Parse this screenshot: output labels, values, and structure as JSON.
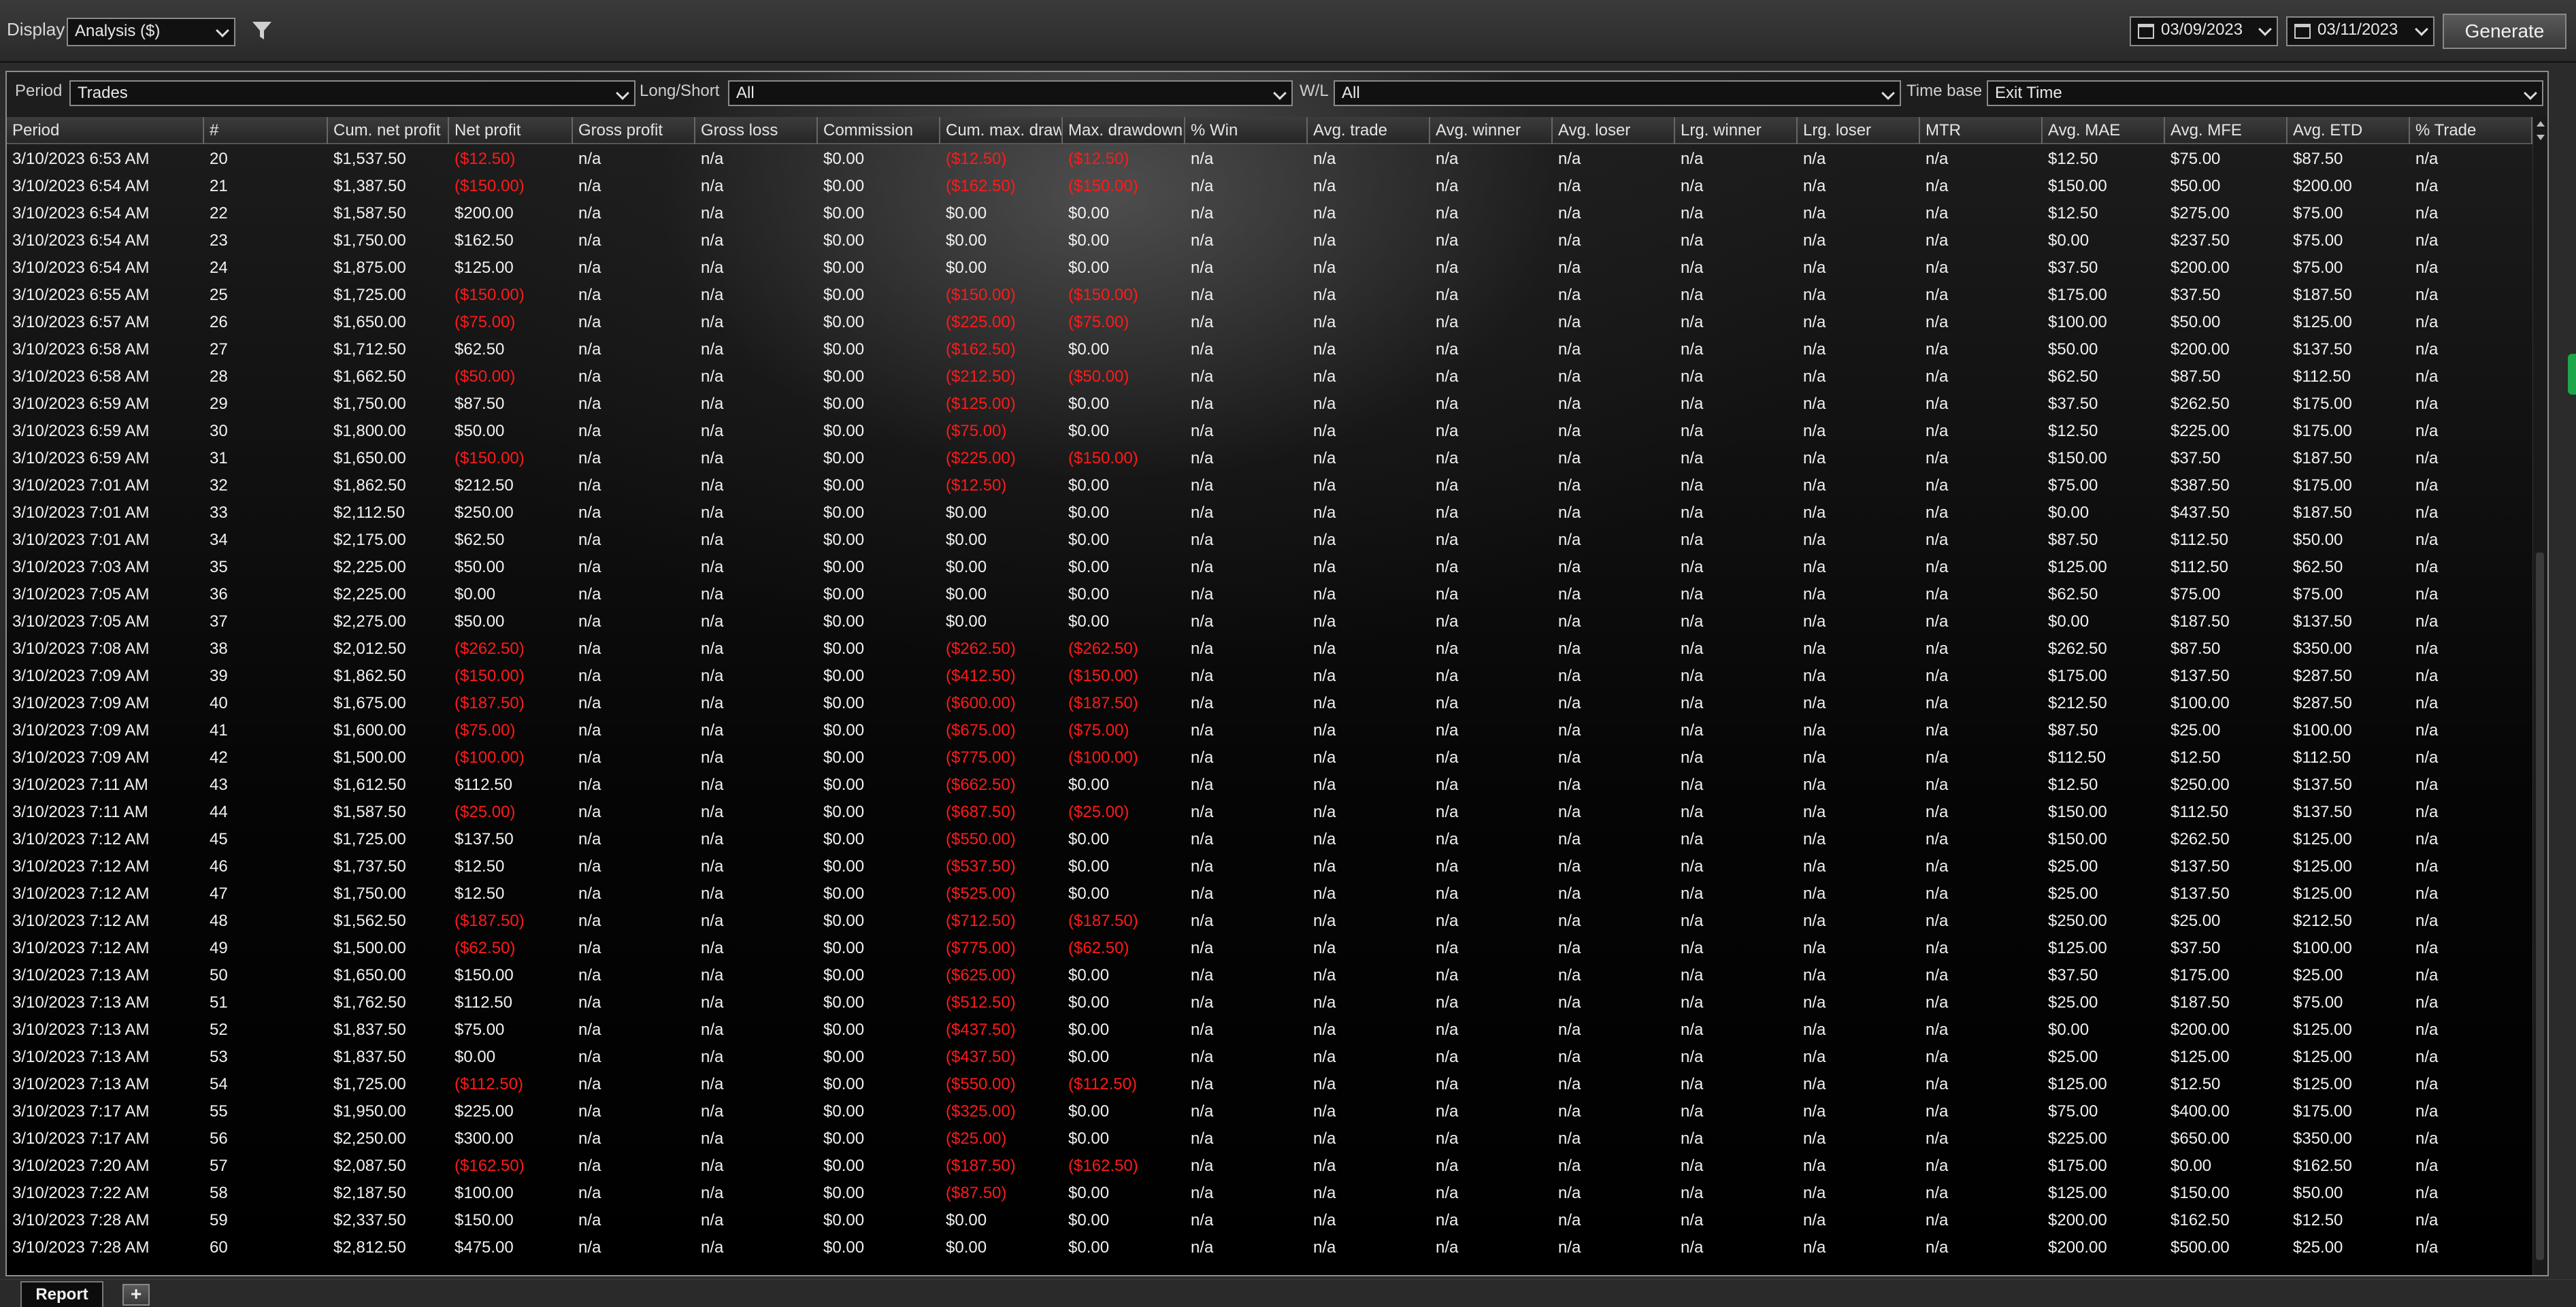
{
  "toolbar": {
    "display_label": "Display",
    "display_value": "Analysis ($)",
    "date_start": "03/09/2023",
    "date_end": "03/11/2023",
    "generate_label": "Generate"
  },
  "filters": {
    "period_label": "Period",
    "period_value": "Trades",
    "longshort_label": "Long/Short",
    "longshort_value": "All",
    "wl_label": "W/L",
    "wl_value": "All",
    "timebase_label": "Time base",
    "timebase_value": "Exit Time"
  },
  "columns": [
    "Period",
    "#",
    "Cum. net profit",
    "Net profit",
    "Gross profit",
    "Gross loss",
    "Commission",
    "Cum. max. drawdown",
    "Max. drawdown",
    "% Win",
    "Avg. trade",
    "Avg. winner",
    "Avg. loser",
    "Lrg. winner",
    "Lrg. loser",
    "MTR",
    "Avg. MAE",
    "Avg. MFE",
    "Avg. ETD",
    "% Trade"
  ],
  "rows": [
    [
      "3/10/2023 6:53 AM",
      "20",
      "$1,537.50",
      "($12.50)",
      "n/a",
      "n/a",
      "$0.00",
      "($12.50)",
      "($12.50)",
      "n/a",
      "n/a",
      "n/a",
      "n/a",
      "n/a",
      "n/a",
      "n/a",
      "$12.50",
      "$75.00",
      "$87.50",
      "n/a"
    ],
    [
      "3/10/2023 6:54 AM",
      "21",
      "$1,387.50",
      "($150.00)",
      "n/a",
      "n/a",
      "$0.00",
      "($162.50)",
      "($150.00)",
      "n/a",
      "n/a",
      "n/a",
      "n/a",
      "n/a",
      "n/a",
      "n/a",
      "$150.00",
      "$50.00",
      "$200.00",
      "n/a"
    ],
    [
      "3/10/2023 6:54 AM",
      "22",
      "$1,587.50",
      "$200.00",
      "n/a",
      "n/a",
      "$0.00",
      "$0.00",
      "$0.00",
      "n/a",
      "n/a",
      "n/a",
      "n/a",
      "n/a",
      "n/a",
      "n/a",
      "$12.50",
      "$275.00",
      "$75.00",
      "n/a"
    ],
    [
      "3/10/2023 6:54 AM",
      "23",
      "$1,750.00",
      "$162.50",
      "n/a",
      "n/a",
      "$0.00",
      "$0.00",
      "$0.00",
      "n/a",
      "n/a",
      "n/a",
      "n/a",
      "n/a",
      "n/a",
      "n/a",
      "$0.00",
      "$237.50",
      "$75.00",
      "n/a"
    ],
    [
      "3/10/2023 6:54 AM",
      "24",
      "$1,875.00",
      "$125.00",
      "n/a",
      "n/a",
      "$0.00",
      "$0.00",
      "$0.00",
      "n/a",
      "n/a",
      "n/a",
      "n/a",
      "n/a",
      "n/a",
      "n/a",
      "$37.50",
      "$200.00",
      "$75.00",
      "n/a"
    ],
    [
      "3/10/2023 6:55 AM",
      "25",
      "$1,725.00",
      "($150.00)",
      "n/a",
      "n/a",
      "$0.00",
      "($150.00)",
      "($150.00)",
      "n/a",
      "n/a",
      "n/a",
      "n/a",
      "n/a",
      "n/a",
      "n/a",
      "$175.00",
      "$37.50",
      "$187.50",
      "n/a"
    ],
    [
      "3/10/2023 6:57 AM",
      "26",
      "$1,650.00",
      "($75.00)",
      "n/a",
      "n/a",
      "$0.00",
      "($225.00)",
      "($75.00)",
      "n/a",
      "n/a",
      "n/a",
      "n/a",
      "n/a",
      "n/a",
      "n/a",
      "$100.00",
      "$50.00",
      "$125.00",
      "n/a"
    ],
    [
      "3/10/2023 6:58 AM",
      "27",
      "$1,712.50",
      "$62.50",
      "n/a",
      "n/a",
      "$0.00",
      "($162.50)",
      "$0.00",
      "n/a",
      "n/a",
      "n/a",
      "n/a",
      "n/a",
      "n/a",
      "n/a",
      "$50.00",
      "$200.00",
      "$137.50",
      "n/a"
    ],
    [
      "3/10/2023 6:58 AM",
      "28",
      "$1,662.50",
      "($50.00)",
      "n/a",
      "n/a",
      "$0.00",
      "($212.50)",
      "($50.00)",
      "n/a",
      "n/a",
      "n/a",
      "n/a",
      "n/a",
      "n/a",
      "n/a",
      "$62.50",
      "$87.50",
      "$112.50",
      "n/a"
    ],
    [
      "3/10/2023 6:59 AM",
      "29",
      "$1,750.00",
      "$87.50",
      "n/a",
      "n/a",
      "$0.00",
      "($125.00)",
      "$0.00",
      "n/a",
      "n/a",
      "n/a",
      "n/a",
      "n/a",
      "n/a",
      "n/a",
      "$37.50",
      "$262.50",
      "$175.00",
      "n/a"
    ],
    [
      "3/10/2023 6:59 AM",
      "30",
      "$1,800.00",
      "$50.00",
      "n/a",
      "n/a",
      "$0.00",
      "($75.00)",
      "$0.00",
      "n/a",
      "n/a",
      "n/a",
      "n/a",
      "n/a",
      "n/a",
      "n/a",
      "$12.50",
      "$225.00",
      "$175.00",
      "n/a"
    ],
    [
      "3/10/2023 6:59 AM",
      "31",
      "$1,650.00",
      "($150.00)",
      "n/a",
      "n/a",
      "$0.00",
      "($225.00)",
      "($150.00)",
      "n/a",
      "n/a",
      "n/a",
      "n/a",
      "n/a",
      "n/a",
      "n/a",
      "$150.00",
      "$37.50",
      "$187.50",
      "n/a"
    ],
    [
      "3/10/2023 7:01 AM",
      "32",
      "$1,862.50",
      "$212.50",
      "n/a",
      "n/a",
      "$0.00",
      "($12.50)",
      "$0.00",
      "n/a",
      "n/a",
      "n/a",
      "n/a",
      "n/a",
      "n/a",
      "n/a",
      "$75.00",
      "$387.50",
      "$175.00",
      "n/a"
    ],
    [
      "3/10/2023 7:01 AM",
      "33",
      "$2,112.50",
      "$250.00",
      "n/a",
      "n/a",
      "$0.00",
      "$0.00",
      "$0.00",
      "n/a",
      "n/a",
      "n/a",
      "n/a",
      "n/a",
      "n/a",
      "n/a",
      "$0.00",
      "$437.50",
      "$187.50",
      "n/a"
    ],
    [
      "3/10/2023 7:01 AM",
      "34",
      "$2,175.00",
      "$62.50",
      "n/a",
      "n/a",
      "$0.00",
      "$0.00",
      "$0.00",
      "n/a",
      "n/a",
      "n/a",
      "n/a",
      "n/a",
      "n/a",
      "n/a",
      "$87.50",
      "$112.50",
      "$50.00",
      "n/a"
    ],
    [
      "3/10/2023 7:03 AM",
      "35",
      "$2,225.00",
      "$50.00",
      "n/a",
      "n/a",
      "$0.00",
      "$0.00",
      "$0.00",
      "n/a",
      "n/a",
      "n/a",
      "n/a",
      "n/a",
      "n/a",
      "n/a",
      "$125.00",
      "$112.50",
      "$62.50",
      "n/a"
    ],
    [
      "3/10/2023 7:05 AM",
      "36",
      "$2,225.00",
      "$0.00",
      "n/a",
      "n/a",
      "$0.00",
      "$0.00",
      "$0.00",
      "n/a",
      "n/a",
      "n/a",
      "n/a",
      "n/a",
      "n/a",
      "n/a",
      "$62.50",
      "$75.00",
      "$75.00",
      "n/a"
    ],
    [
      "3/10/2023 7:05 AM",
      "37",
      "$2,275.00",
      "$50.00",
      "n/a",
      "n/a",
      "$0.00",
      "$0.00",
      "$0.00",
      "n/a",
      "n/a",
      "n/a",
      "n/a",
      "n/a",
      "n/a",
      "n/a",
      "$0.00",
      "$187.50",
      "$137.50",
      "n/a"
    ],
    [
      "3/10/2023 7:08 AM",
      "38",
      "$2,012.50",
      "($262.50)",
      "n/a",
      "n/a",
      "$0.00",
      "($262.50)",
      "($262.50)",
      "n/a",
      "n/a",
      "n/a",
      "n/a",
      "n/a",
      "n/a",
      "n/a",
      "$262.50",
      "$87.50",
      "$350.00",
      "n/a"
    ],
    [
      "3/10/2023 7:09 AM",
      "39",
      "$1,862.50",
      "($150.00)",
      "n/a",
      "n/a",
      "$0.00",
      "($412.50)",
      "($150.00)",
      "n/a",
      "n/a",
      "n/a",
      "n/a",
      "n/a",
      "n/a",
      "n/a",
      "$175.00",
      "$137.50",
      "$287.50",
      "n/a"
    ],
    [
      "3/10/2023 7:09 AM",
      "40",
      "$1,675.00",
      "($187.50)",
      "n/a",
      "n/a",
      "$0.00",
      "($600.00)",
      "($187.50)",
      "n/a",
      "n/a",
      "n/a",
      "n/a",
      "n/a",
      "n/a",
      "n/a",
      "$212.50",
      "$100.00",
      "$287.50",
      "n/a"
    ],
    [
      "3/10/2023 7:09 AM",
      "41",
      "$1,600.00",
      "($75.00)",
      "n/a",
      "n/a",
      "$0.00",
      "($675.00)",
      "($75.00)",
      "n/a",
      "n/a",
      "n/a",
      "n/a",
      "n/a",
      "n/a",
      "n/a",
      "$87.50",
      "$25.00",
      "$100.00",
      "n/a"
    ],
    [
      "3/10/2023 7:09 AM",
      "42",
      "$1,500.00",
      "($100.00)",
      "n/a",
      "n/a",
      "$0.00",
      "($775.00)",
      "($100.00)",
      "n/a",
      "n/a",
      "n/a",
      "n/a",
      "n/a",
      "n/a",
      "n/a",
      "$112.50",
      "$12.50",
      "$112.50",
      "n/a"
    ],
    [
      "3/10/2023 7:11 AM",
      "43",
      "$1,612.50",
      "$112.50",
      "n/a",
      "n/a",
      "$0.00",
      "($662.50)",
      "$0.00",
      "n/a",
      "n/a",
      "n/a",
      "n/a",
      "n/a",
      "n/a",
      "n/a",
      "$12.50",
      "$250.00",
      "$137.50",
      "n/a"
    ],
    [
      "3/10/2023 7:11 AM",
      "44",
      "$1,587.50",
      "($25.00)",
      "n/a",
      "n/a",
      "$0.00",
      "($687.50)",
      "($25.00)",
      "n/a",
      "n/a",
      "n/a",
      "n/a",
      "n/a",
      "n/a",
      "n/a",
      "$150.00",
      "$112.50",
      "$137.50",
      "n/a"
    ],
    [
      "3/10/2023 7:12 AM",
      "45",
      "$1,725.00",
      "$137.50",
      "n/a",
      "n/a",
      "$0.00",
      "($550.00)",
      "$0.00",
      "n/a",
      "n/a",
      "n/a",
      "n/a",
      "n/a",
      "n/a",
      "n/a",
      "$150.00",
      "$262.50",
      "$125.00",
      "n/a"
    ],
    [
      "3/10/2023 7:12 AM",
      "46",
      "$1,737.50",
      "$12.50",
      "n/a",
      "n/a",
      "$0.00",
      "($537.50)",
      "$0.00",
      "n/a",
      "n/a",
      "n/a",
      "n/a",
      "n/a",
      "n/a",
      "n/a",
      "$25.00",
      "$137.50",
      "$125.00",
      "n/a"
    ],
    [
      "3/10/2023 7:12 AM",
      "47",
      "$1,750.00",
      "$12.50",
      "n/a",
      "n/a",
      "$0.00",
      "($525.00)",
      "$0.00",
      "n/a",
      "n/a",
      "n/a",
      "n/a",
      "n/a",
      "n/a",
      "n/a",
      "$25.00",
      "$137.50",
      "$125.00",
      "n/a"
    ],
    [
      "3/10/2023 7:12 AM",
      "48",
      "$1,562.50",
      "($187.50)",
      "n/a",
      "n/a",
      "$0.00",
      "($712.50)",
      "($187.50)",
      "n/a",
      "n/a",
      "n/a",
      "n/a",
      "n/a",
      "n/a",
      "n/a",
      "$250.00",
      "$25.00",
      "$212.50",
      "n/a"
    ],
    [
      "3/10/2023 7:12 AM",
      "49",
      "$1,500.00",
      "($62.50)",
      "n/a",
      "n/a",
      "$0.00",
      "($775.00)",
      "($62.50)",
      "n/a",
      "n/a",
      "n/a",
      "n/a",
      "n/a",
      "n/a",
      "n/a",
      "$125.00",
      "$37.50",
      "$100.00",
      "n/a"
    ],
    [
      "3/10/2023 7:13 AM",
      "50",
      "$1,650.00",
      "$150.00",
      "n/a",
      "n/a",
      "$0.00",
      "($625.00)",
      "$0.00",
      "n/a",
      "n/a",
      "n/a",
      "n/a",
      "n/a",
      "n/a",
      "n/a",
      "$37.50",
      "$175.00",
      "$25.00",
      "n/a"
    ],
    [
      "3/10/2023 7:13 AM",
      "51",
      "$1,762.50",
      "$112.50",
      "n/a",
      "n/a",
      "$0.00",
      "($512.50)",
      "$0.00",
      "n/a",
      "n/a",
      "n/a",
      "n/a",
      "n/a",
      "n/a",
      "n/a",
      "$25.00",
      "$187.50",
      "$75.00",
      "n/a"
    ],
    [
      "3/10/2023 7:13 AM",
      "52",
      "$1,837.50",
      "$75.00",
      "n/a",
      "n/a",
      "$0.00",
      "($437.50)",
      "$0.00",
      "n/a",
      "n/a",
      "n/a",
      "n/a",
      "n/a",
      "n/a",
      "n/a",
      "$0.00",
      "$200.00",
      "$125.00",
      "n/a"
    ],
    [
      "3/10/2023 7:13 AM",
      "53",
      "$1,837.50",
      "$0.00",
      "n/a",
      "n/a",
      "$0.00",
      "($437.50)",
      "$0.00",
      "n/a",
      "n/a",
      "n/a",
      "n/a",
      "n/a",
      "n/a",
      "n/a",
      "$25.00",
      "$125.00",
      "$125.00",
      "n/a"
    ],
    [
      "3/10/2023 7:13 AM",
      "54",
      "$1,725.00",
      "($112.50)",
      "n/a",
      "n/a",
      "$0.00",
      "($550.00)",
      "($112.50)",
      "n/a",
      "n/a",
      "n/a",
      "n/a",
      "n/a",
      "n/a",
      "n/a",
      "$125.00",
      "$12.50",
      "$125.00",
      "n/a"
    ],
    [
      "3/10/2023 7:17 AM",
      "55",
      "$1,950.00",
      "$225.00",
      "n/a",
      "n/a",
      "$0.00",
      "($325.00)",
      "$0.00",
      "n/a",
      "n/a",
      "n/a",
      "n/a",
      "n/a",
      "n/a",
      "n/a",
      "$75.00",
      "$400.00",
      "$175.00",
      "n/a"
    ],
    [
      "3/10/2023 7:17 AM",
      "56",
      "$2,250.00",
      "$300.00",
      "n/a",
      "n/a",
      "$0.00",
      "($25.00)",
      "$0.00",
      "n/a",
      "n/a",
      "n/a",
      "n/a",
      "n/a",
      "n/a",
      "n/a",
      "$225.00",
      "$650.00",
      "$350.00",
      "n/a"
    ],
    [
      "3/10/2023 7:20 AM",
      "57",
      "$2,087.50",
      "($162.50)",
      "n/a",
      "n/a",
      "$0.00",
      "($187.50)",
      "($162.50)",
      "n/a",
      "n/a",
      "n/a",
      "n/a",
      "n/a",
      "n/a",
      "n/a",
      "$175.00",
      "$0.00",
      "$162.50",
      "n/a"
    ],
    [
      "3/10/2023 7:22 AM",
      "58",
      "$2,187.50",
      "$100.00",
      "n/a",
      "n/a",
      "$0.00",
      "($87.50)",
      "$0.00",
      "n/a",
      "n/a",
      "n/a",
      "n/a",
      "n/a",
      "n/a",
      "n/a",
      "$125.00",
      "$150.00",
      "$50.00",
      "n/a"
    ],
    [
      "3/10/2023 7:28 AM",
      "59",
      "$2,337.50",
      "$150.00",
      "n/a",
      "n/a",
      "$0.00",
      "$0.00",
      "$0.00",
      "n/a",
      "n/a",
      "n/a",
      "n/a",
      "n/a",
      "n/a",
      "n/a",
      "$200.00",
      "$162.50",
      "$12.50",
      "n/a"
    ],
    [
      "3/10/2023 7:28 AM",
      "60",
      "$2,812.50",
      "$475.00",
      "n/a",
      "n/a",
      "$0.00",
      "$0.00",
      "$0.00",
      "n/a",
      "n/a",
      "n/a",
      "n/a",
      "n/a",
      "n/a",
      "n/a",
      "$200.00",
      "$500.00",
      "$25.00",
      "n/a"
    ]
  ],
  "tabs": {
    "report_label": "Report",
    "add_label": "+"
  },
  "colors": {
    "negative": "#ff1a1a",
    "positive": "#f2f2f2",
    "accent": "#1ea64a"
  }
}
